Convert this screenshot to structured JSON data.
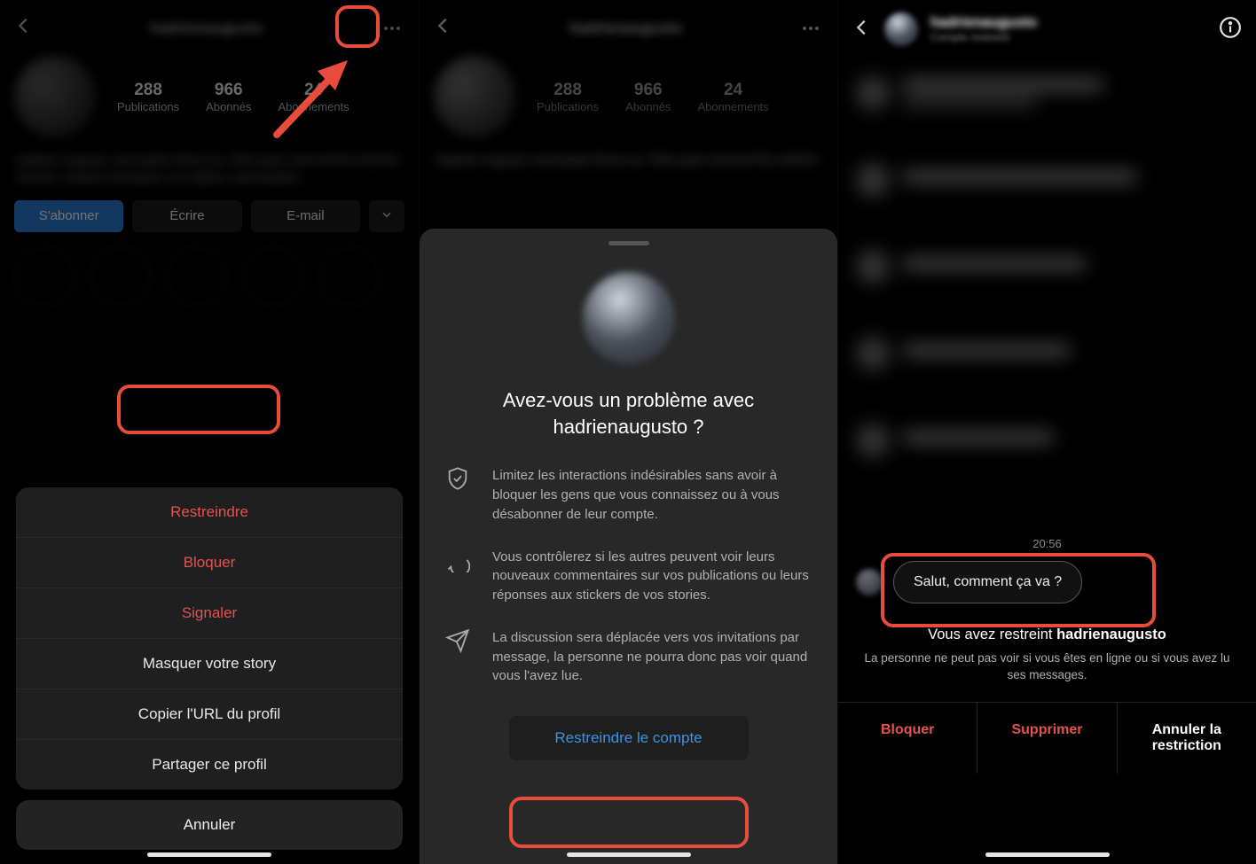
{
  "username_blurred": "hadrienaugusto",
  "panel1": {
    "topbar_title": "hadrienaugusto",
    "stats": [
      {
        "num": "288",
        "lbl": "Publications"
      },
      {
        "num": "966",
        "lbl": "Abonnés"
      },
      {
        "num": "24",
        "lbl": "Abonnements"
      }
    ],
    "bio_lines": "Hadrien Augusto\nJournaliste\nÉlevé au 7000\nparle internet/TELUSDIGI\nToronto, Ontario\nAnimateur sur\néditeur coloriseation.",
    "btn_follow": "S'abonner",
    "btn_message": "Écrire",
    "btn_email": "E-mail",
    "sheet": {
      "restrict": "Restreindre",
      "block": "Bloquer",
      "report": "Signaler",
      "hide_story": "Masquer votre story",
      "copy_url": "Copier l'URL du profil",
      "share": "Partager ce profil",
      "cancel": "Annuler"
    }
  },
  "panel2": {
    "topbar_title": "hadrienaugusto",
    "stats": [
      {
        "num": "288",
        "lbl": "Publications"
      },
      {
        "num": "966",
        "lbl": "Abonnés"
      },
      {
        "num": "24",
        "lbl": "Abonnements"
      }
    ],
    "bio_lines": "Hadrien Augusto\nJournaliste\nÉlevé au 7000\nparle internet/TELUSDIGI",
    "modal": {
      "title_l1": "Avez-vous un problème avec",
      "title_l2": "hadrienaugusto ?",
      "info1": "Limitez les interactions indésirables sans avoir à bloquer les gens que vous connaissez ou à vous désabonner de leur compte.",
      "info2": "Vous contrôlerez si les autres peuvent voir leurs nouveaux commentaires sur vos publications ou leurs réponses aux stickers de vos stories.",
      "info3": "La discussion sera déplacée vers vos invitations par message, la personne ne pourra donc pas voir quand vous l'avez lue.",
      "button": "Restreindre le compte"
    }
  },
  "panel3": {
    "name": "hadrienaugusto",
    "sub": "Compte restreint",
    "time": "20:56",
    "bubble": "Salut, comment ça va ?",
    "banner_pre": "Vous avez restreint ",
    "banner_user": "hadrienaugusto",
    "banner_sub": "La personne ne peut pas voir si vous êtes en ligne ou si vous avez lu ses messages.",
    "act_block": "Bloquer",
    "act_delete": "Supprimer",
    "act_unrestrict_l1": "Annuler la",
    "act_unrestrict_l2": "restriction"
  }
}
